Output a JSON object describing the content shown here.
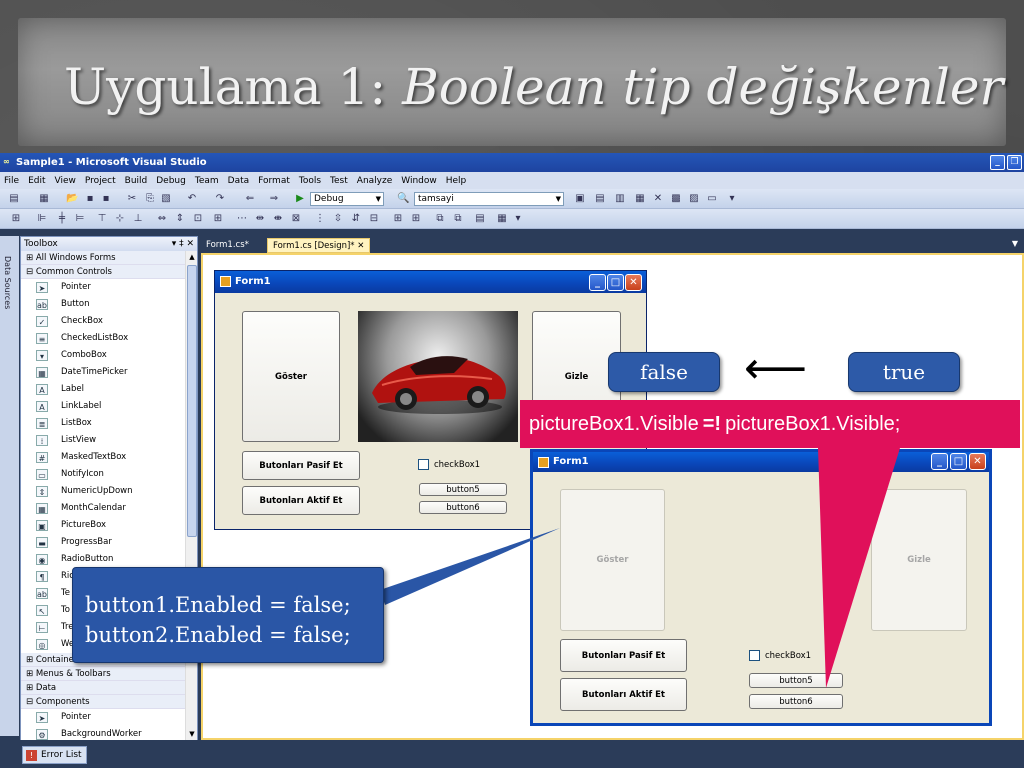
{
  "slide": {
    "title_normal": "Uygulama 1: ",
    "title_italic": "Boolean tip değişkenler"
  },
  "window": {
    "title": "Sample1 - Microsoft Visual Studio"
  },
  "menu": [
    "File",
    "Edit",
    "View",
    "Project",
    "Build",
    "Debug",
    "Team",
    "Data",
    "Format",
    "Tools",
    "Test",
    "Analyze",
    "Window",
    "Help"
  ],
  "toolbar": {
    "config_value": "Debug",
    "find_value": "tamsayi"
  },
  "left_strip": {
    "label": "Data Sources"
  },
  "toolbox": {
    "title": "Toolbox",
    "pin_glyph": "▾ ‡ ✕",
    "groups_top": [
      "All Windows Forms",
      "Common Controls"
    ],
    "items": [
      {
        "label": "Pointer",
        "icon": "pointer-icon",
        "glyph": "➤"
      },
      {
        "label": "Button",
        "icon": "button-icon",
        "glyph": "ab"
      },
      {
        "label": "CheckBox",
        "icon": "checkbox-icon",
        "glyph": "✓"
      },
      {
        "label": "CheckedListBox",
        "icon": "checkedlistbox-icon",
        "glyph": "≡"
      },
      {
        "label": "ComboBox",
        "icon": "combobox-icon",
        "glyph": "▾"
      },
      {
        "label": "DateTimePicker",
        "icon": "datetimepicker-icon",
        "glyph": "▦"
      },
      {
        "label": "Label",
        "icon": "label-icon",
        "glyph": "A"
      },
      {
        "label": "LinkLabel",
        "icon": "linklabel-icon",
        "glyph": "A"
      },
      {
        "label": "ListBox",
        "icon": "listbox-icon",
        "glyph": "≣"
      },
      {
        "label": "ListView",
        "icon": "listview-icon",
        "glyph": "⁞"
      },
      {
        "label": "MaskedTextBox",
        "icon": "maskedtextbox-icon",
        "glyph": "#"
      },
      {
        "label": "NotifyIcon",
        "icon": "notifyicon-icon",
        "glyph": "▭"
      },
      {
        "label": "NumericUpDown",
        "icon": "numericupdown-icon",
        "glyph": "⇕"
      },
      {
        "label": "MonthCalendar",
        "icon": "monthcalendar-icon",
        "glyph": "▦"
      },
      {
        "label": "PictureBox",
        "icon": "picturebox-icon",
        "glyph": "▣"
      },
      {
        "label": "ProgressBar",
        "icon": "progressbar-icon",
        "glyph": "▬"
      },
      {
        "label": "RadioButton",
        "icon": "radiobutton-icon",
        "glyph": "◉"
      },
      {
        "label": "Ric",
        "icon": "richtextbox-icon",
        "glyph": "¶"
      },
      {
        "label": "Te",
        "icon": "textbox-icon",
        "glyph": "ab"
      },
      {
        "label": "To",
        "icon": "tooltip-icon",
        "glyph": "↖"
      },
      {
        "label": "Tre",
        "icon": "treeview-icon",
        "glyph": "⊢"
      },
      {
        "label": "We",
        "icon": "webbrowser-icon",
        "glyph": "◎"
      }
    ],
    "groups_bottom": [
      "Containers",
      "Menus & Toolbars",
      "Data",
      "Components"
    ],
    "component_items": [
      {
        "label": "Pointer",
        "icon": "pointer-icon",
        "glyph": "➤"
      },
      {
        "label": "BackgroundWorker",
        "icon": "backgroundworker-icon",
        "glyph": "⚙"
      }
    ]
  },
  "doc_tabs": [
    "Form1.cs*",
    "Form1.cs [Design]*"
  ],
  "form_top": {
    "title": "Form1",
    "goster": "Göster",
    "gizle": "Gizle",
    "pasif": "Butonları Pasif Et",
    "aktif": "Butonları Aktif Et",
    "checkbox": "checkBox1",
    "button5": "button5",
    "button6": "button6"
  },
  "form_bottom": {
    "title": "Form1",
    "goster": "Göster",
    "gizle": "Gizle",
    "pasif": "Butonları Pasif Et",
    "aktif": "Butonları Aktif Et",
    "checkbox": "checkBox1",
    "button5": "button5",
    "button6": "button6"
  },
  "callouts": {
    "false_label": "false",
    "true_label": "true",
    "arrow_glyph": "⟵",
    "code_line1": "button1.Enabled = false;",
    "code_line2": "button2.Enabled = false;",
    "visible_left": "pictureBox1.Visible",
    "visible_op": "=!",
    "visible_right": "pictureBox1.Visible;"
  },
  "status": {
    "error_list": "Error List"
  },
  "colors": {
    "callout_blue": "#2a56a6",
    "callout_pink": "#e0105a",
    "xp_title_blue": "#0a46b8"
  }
}
